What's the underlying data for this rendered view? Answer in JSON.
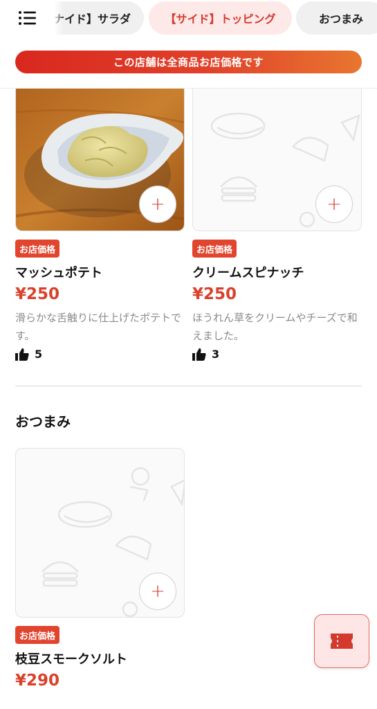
{
  "header": {
    "tabs": [
      {
        "label": "ナイド】サラダ"
      },
      {
        "label": "【サイド】トッピング"
      },
      {
        "label": "おつまみ"
      }
    ],
    "banner": "この店舗は全商品お店価格です"
  },
  "items": [
    {
      "badge": "お店価格",
      "name": "マッシュポテト",
      "price": "¥250",
      "desc": "滑らかな舌触りに仕上げたポテトです。",
      "likes": "5"
    },
    {
      "badge": "お店価格",
      "name": "クリームスピナッチ",
      "price": "¥250",
      "desc": "ほうれん草をクリームやチーズで和えました。",
      "likes": "3"
    },
    {
      "badge": "お店価格",
      "name": "枝豆スモークソルト",
      "price": "¥290"
    }
  ],
  "section": {
    "title": "おつまみ"
  },
  "icons": {
    "menu": "menu-icon",
    "plus": "plus-icon",
    "like": "thumbs-up-icon",
    "cart": "ticket-icon"
  },
  "colors": {
    "accent": "#d9412b",
    "badge": "#e1452e",
    "tab_active_bg": "#fde9e8"
  }
}
